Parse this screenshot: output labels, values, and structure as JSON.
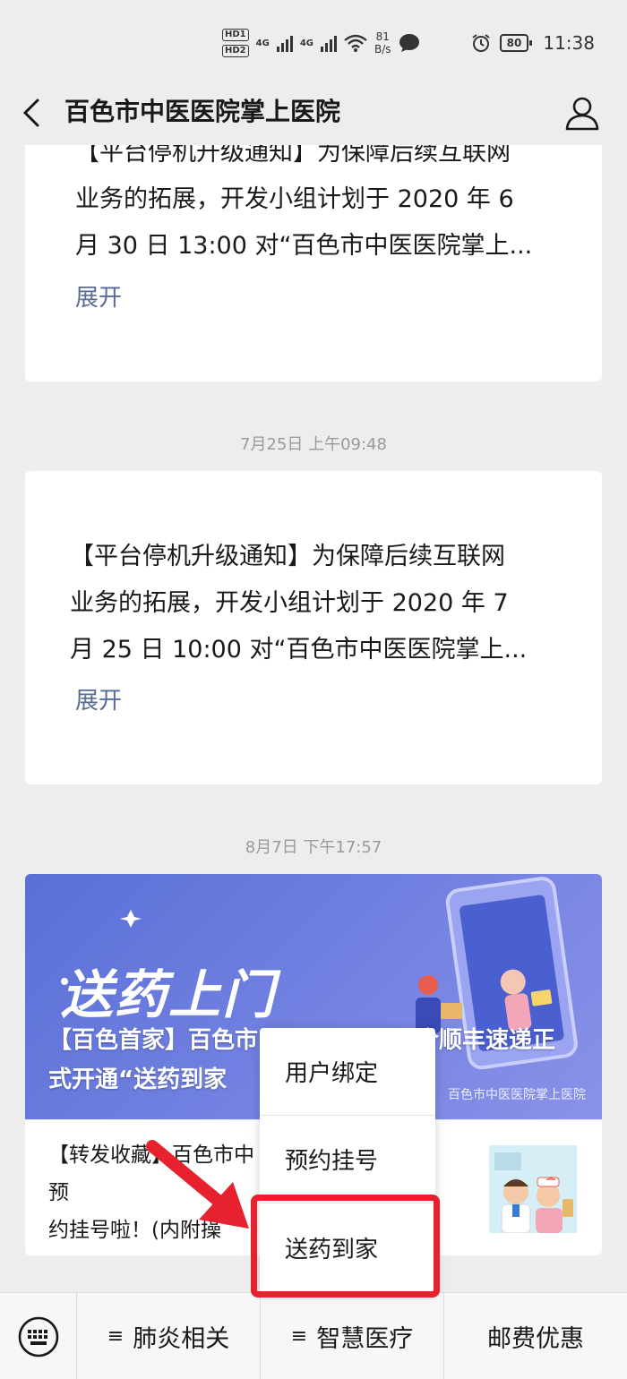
{
  "status_bar": {
    "hd1": "HD1",
    "hd2": "HD2",
    "sig1": "4G",
    "sig2": "4G",
    "speed_value": "81",
    "speed_unit": "B/s",
    "battery": "80",
    "time": "11:38"
  },
  "nav": {
    "title": "百色市中医医院掌上医院"
  },
  "messages": [
    {
      "text": "【平台停机升级通知】为保障后续互联网\n业务的拓展，开发小组计划于 2020 年 6\n月 30 日 13:00 对“百色市中医医院掌上...",
      "expand_label": "展开"
    },
    {
      "timestamp": "7月25日 上午09:48",
      "text": "【平台停机升级通知】为保障后续互联网\n业务的拓展，开发小组计划于 2020 年 7\n月 25 日 10:00 对“百色市中医医院掌上...",
      "expand_label": "展开"
    }
  ],
  "article": {
    "timestamp": "8月7日 下午17:57",
    "cover_art_text": "送药上门",
    "cover_title_1": "【百色首家】百色市",
    "cover_title_1b": "合顺丰速递正",
    "cover_title_2": "式开通“送药到家",
    "cover_source": "百色市中医医院掌上医院",
    "sub_text_1": "【转发收藏】百色市中",
    "sub_text_1b": "预",
    "sub_text_2": "约挂号啦！(内附操"
  },
  "popup_menu": {
    "items": [
      "用户绑定",
      "预约挂号",
      "送药到家"
    ]
  },
  "bottom_menu": {
    "tabs": [
      "肺炎相关",
      "智慧医疗",
      "邮费优惠"
    ],
    "menu_mark": "≡"
  },
  "colors": {
    "link": "#576b95",
    "highlight": "#e8212f",
    "cover_bg": "#6f7fe0"
  }
}
